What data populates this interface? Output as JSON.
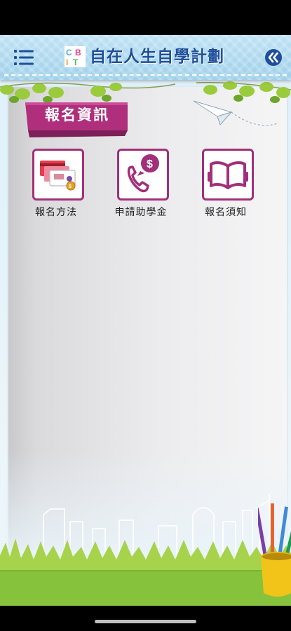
{
  "header": {
    "logo_text": "CBIT",
    "title": "自在人生自學計劃",
    "menu_icon": "menu-list-icon",
    "back_icon": "double-chevron-left-icon"
  },
  "section": {
    "title": "報名資訊"
  },
  "tiles": [
    {
      "label": "報名方法",
      "icon": "payment-cards-icon"
    },
    {
      "label": "申請助學金",
      "icon": "phone-dollar-icon"
    },
    {
      "label": "報名須知",
      "icon": "open-book-icon"
    }
  ],
  "colors": {
    "accent": "#a12f7a",
    "header_bg": "#a9d6ee",
    "title_text": "#1e4f9a",
    "grass": "#8cc63f"
  }
}
